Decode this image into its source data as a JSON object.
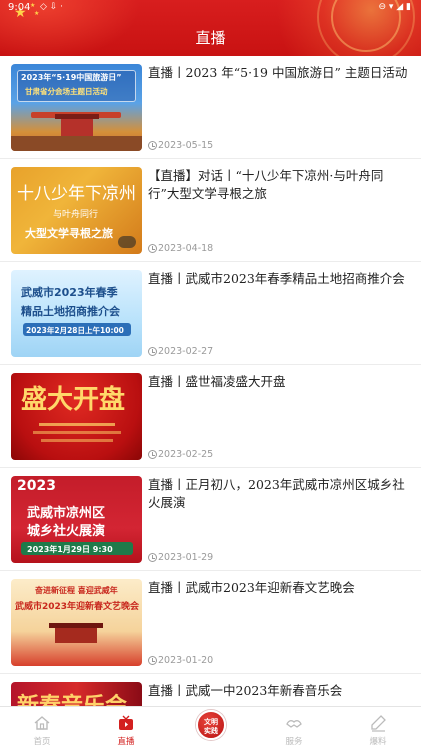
{
  "status_bar": {
    "time": "9:04",
    "extra": "◇ ⇩ ·",
    "right": "⊖ ▾ ◢ ▮"
  },
  "header": {
    "title": "直播"
  },
  "items": [
    {
      "title": "直播丨2023 年“5·19 中国旅游日” 主题日活动",
      "date": "2023-05-15",
      "thumb": {
        "line1": "2023年“5·19中国旅游日”",
        "line2": "甘肃省分会场主题日活动"
      }
    },
    {
      "title": "【直播】对话丨“十八少年下凉州·与叶舟同行”大型文学寻根之旅",
      "date": "2023-04-18",
      "thumb": {
        "line1": "十八少年下凉州",
        "line2": "与叶舟同行",
        "line3": "大型文学寻根之旅"
      }
    },
    {
      "title": "直播丨武威市2023年春季精品土地招商推介会",
      "date": "2023-02-27",
      "thumb": {
        "line1": "武威市2023年春季",
        "line2": "精品土地招商推介会",
        "line3": "2023年2月28日上午10:00"
      }
    },
    {
      "title": "直播丨盛世福凌盛大开盘",
      "date": "2023-02-25",
      "thumb": {
        "line1": "盛大开盘"
      }
    },
    {
      "title": "直播丨正月初八，2023年武威市凉州区城乡社火展演",
      "date": "2023-01-29",
      "thumb": {
        "line0": "2023",
        "line1": "武威市凉州区",
        "line2": "城乡社火展演",
        "line3": "2023年1月29日 9:30"
      }
    },
    {
      "title": "直播丨武威市2023年迎新春文艺晚会",
      "date": "2023-01-20",
      "thumb": {
        "line0": "奋进新征程 喜迎武威年",
        "line1": "武威市2023年迎新春文艺晚会"
      }
    },
    {
      "title": "直播丨武威一中2023年新春音乐会",
      "date": "",
      "thumb": {
        "line1": "新春音乐会"
      }
    }
  ],
  "tabbar": {
    "tabs": [
      {
        "label": "首页",
        "icon": "home-icon"
      },
      {
        "label": "直播",
        "icon": "live-tv-icon"
      },
      {
        "label": "文明实践",
        "icon": "civilization-badge-icon"
      },
      {
        "label": "服务",
        "icon": "service-icon"
      },
      {
        "label": "爆料",
        "icon": "report-pen-icon"
      }
    ],
    "active_index": 1,
    "accent_color": "#d3201f"
  }
}
